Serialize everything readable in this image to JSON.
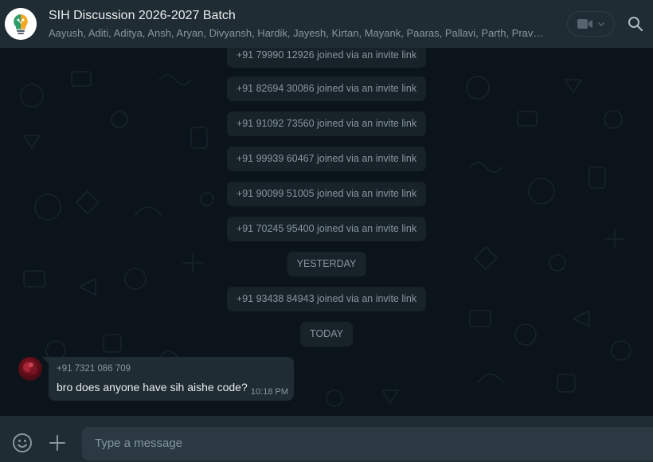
{
  "header": {
    "title": "SIH Discussion 2026-2027 Batch",
    "members": "Aayush, Aditi, Aditya, Ansh, Aryan, Divyansh, Hardik, Jayesh, Kirtan, Mayank, Paaras, Pallavi, Parth, Pravesh, ...",
    "video_icon": "video-camera-icon",
    "dropdown_icon": "chevron-down-icon",
    "search_icon": "search-icon"
  },
  "chat": {
    "system_messages": [
      "+91 79990 12926 joined via an invite link",
      "+91 82694 30086 joined via an invite link",
      "+91 91092 73560 joined via an invite link",
      "+91 99939 60467 joined via an invite link",
      "+91 90099 51005 joined via an invite link",
      "+91 70245 95400 joined via an invite link",
      "+91 93438 84943 joined via an invite link"
    ],
    "dates": [
      "YESTERDAY",
      "TODAY"
    ],
    "message": {
      "sender": "+91 7321 086 709",
      "text": "bro does anyone have sih aishe code?",
      "time": "10:18 PM"
    }
  },
  "footer": {
    "placeholder": "Type a message",
    "emoji_icon": "emoji-icon",
    "attach_icon": "plus-icon"
  },
  "colors": {
    "header_bg": "#202c33",
    "chat_bg": "#0b141a",
    "system_bubble": "#182229",
    "incoming_bubble": "#202c33",
    "input_bg": "#2a3942",
    "muted_text": "#8696a0"
  }
}
